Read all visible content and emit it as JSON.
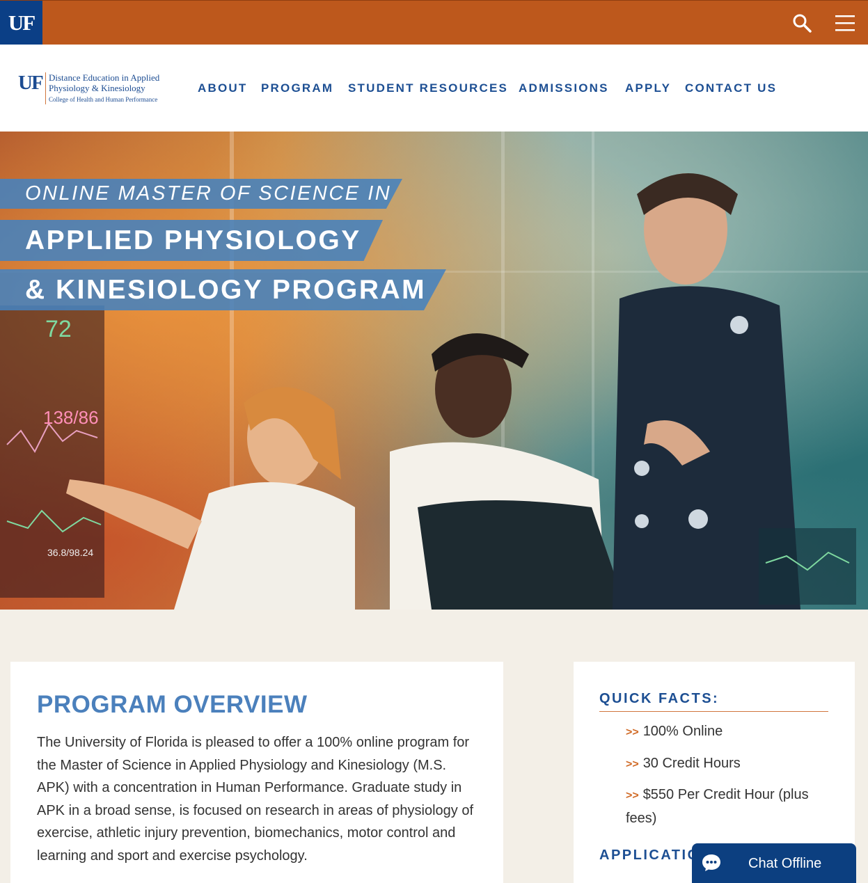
{
  "topbar": {
    "logo_text": "UF",
    "search_icon": "search-icon",
    "menu_icon": "hamburger-menu-icon",
    "color": "#bd581c"
  },
  "header": {
    "logo": {
      "mark": "UF",
      "line1": "Distance Education in Applied",
      "line2": "Physiology & Kinesiology",
      "line3": "College of Health and Human Performance"
    },
    "nav": [
      {
        "label": "ABOUT"
      },
      {
        "label": "PROGRAM"
      },
      {
        "label": "STUDENT RESOURCES"
      },
      {
        "label": "ADMISSIONS"
      },
      {
        "label": "APPLY"
      },
      {
        "label": "CONTACT US"
      }
    ]
  },
  "hero": {
    "line1": "ONLINE MASTER OF SCIENCE IN",
    "line2": "APPLIED PHYSIOLOGY",
    "line3": "& KINESIOLOGY PROGRAM",
    "monitor_text1": "72",
    "monitor_text2": "138/86",
    "monitor_text3": "36.8/98.24"
  },
  "overview": {
    "title": "PROGRAM OVERVIEW",
    "body": "The University of Florida is pleased to offer a 100% online program for the Master of Science in Applied Physiology and Kinesiology (M.S. APK) with a concentration in Human Performance. Graduate study in APK in a broad sense, is focused on research in areas of physiology of exercise, athletic injury prevention, biomechanics, motor control and learning and sport and exercise psychology."
  },
  "facts": {
    "title": "QUICK FACTS:",
    "arrow": ">>",
    "items": [
      "100% Online",
      "30 Credit Hours",
      "$550 Per Credit Hour (plus fees)"
    ],
    "title2": "APPLICATIC"
  },
  "chat": {
    "label": "Chat Offline",
    "icon": "chat-bubble-icon"
  },
  "colors": {
    "brand_blue": "#1d4f93",
    "brand_orange": "#bd581c",
    "accent_blue": "#4b80bc"
  }
}
